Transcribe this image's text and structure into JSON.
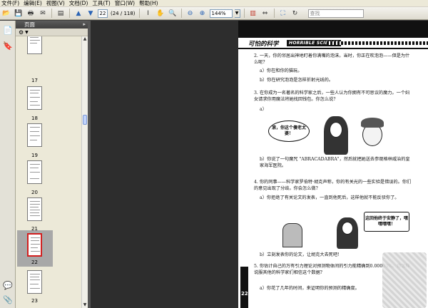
{
  "menu": [
    "文件(F)",
    "编辑(E)",
    "视图(V)",
    "文档(D)",
    "工具(T)",
    "窗口(W)",
    "帮助(H)"
  ],
  "toolbar": {
    "page_current": "22",
    "page_total": "(24 / 118)",
    "zoom": "144%",
    "search_placeholder": "查找"
  },
  "panel": {
    "title": "页面"
  },
  "thumbnails": [
    {
      "label": "17"
    },
    {
      "label": "18"
    },
    {
      "label": "19"
    },
    {
      "label": "20"
    },
    {
      "label": "21"
    },
    {
      "label": "22",
      "selected": true
    },
    {
      "label": "23"
    }
  ],
  "page": {
    "header_title": "可怕的科学",
    "header_brand": "HORRIBLE SCIENCE",
    "page_number": "22",
    "q2": "2. 一天，你的邻居出神地盯着你满嘴的泡沫。当时，你正在吹泡泡——但是为什么呢？",
    "q2a": "a）你在和你的猫玩。",
    "q2b": "b）你在研究泡泡是怎样折射光线的。",
    "q3": "3. 在你成为一名著名的科学家之后，一些人认为你拥有不可思议的魔力。一个妇女请求你用魔法将她找回钱包。你怎么说？",
    "q3a": "a）",
    "bubble1": "滚，你这个傻老太婆！",
    "q3b": "b）你说了一句魔咒 \"ABRACADABRA\"，然后就把她送去参观格林威治的皇家海军医院。",
    "q4": "4. 你的同事——科学家罗伯特·胡克声称，你的有关光的一些实验是错误的。你们的意见出现了分歧。你会怎么做？",
    "q4a": "a）你拒绝了有关论文的发表，一直到他死后，这样他就不能反驳你了。",
    "bubble2": "这回他终于安静了，嘿嘿嘿嘿！",
    "q4b": "b）立刻发表你的论文，让胡克大去死吧！",
    "q5": "5. 你估计自己的万有引力理论对预测物体间的引力能精确到0.00003%。你怎样说服其他的科学家们相信这个数据？",
    "q5a": "a）你花了几年的时间，来证明你的预测的精确度。"
  }
}
